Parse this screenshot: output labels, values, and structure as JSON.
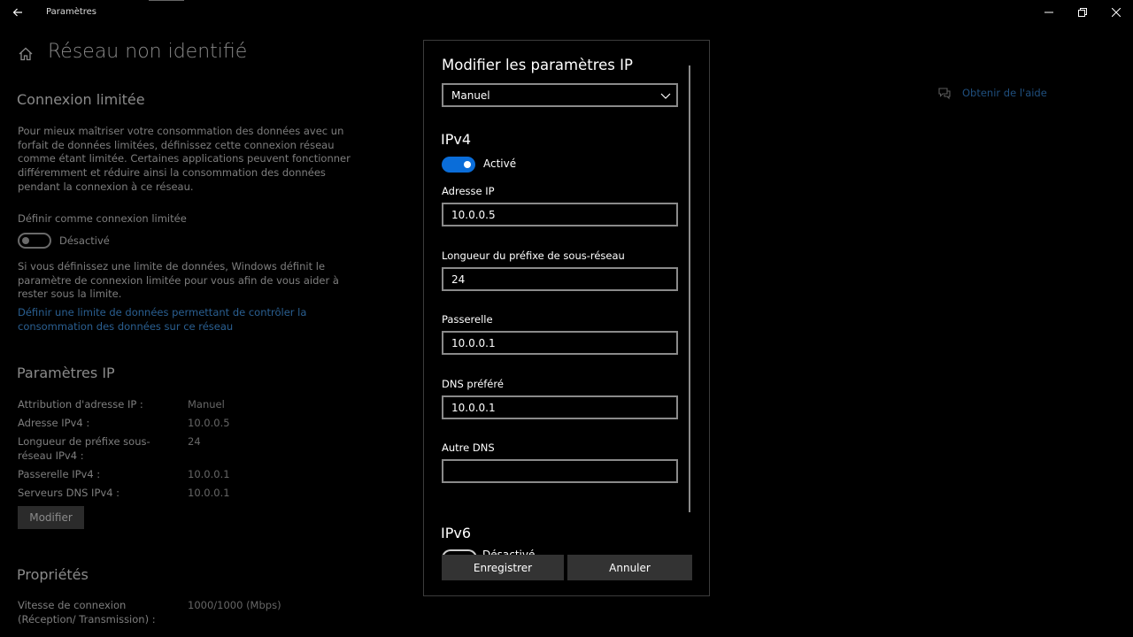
{
  "window": {
    "title": "Paramètres"
  },
  "page": {
    "title": "Réseau non identifié",
    "metered": {
      "heading": "Connexion limitée",
      "description": "Pour mieux maîtriser votre consommation des données avec un forfait de données limitées, définissez cette connexion réseau comme étant limitée. Certaines applications peuvent fonctionner différemment et réduire ainsi la consommation des données pendant la connexion à ce réseau.",
      "toggle_label": "Définir comme connexion limitée",
      "toggle_state": "Désactivé",
      "limit_note": "Si vous définissez une limite de données, Windows définit le paramètre de connexion limitée pour vous afin de vous aider à rester sous la limite.",
      "limit_link": "Définir une limite de données permettant de contrôler la consommation des données sur ce réseau"
    },
    "ip_settings": {
      "heading": "Paramètres IP",
      "rows": [
        {
          "key": "Attribution d'adresse IP :",
          "value": "Manuel"
        },
        {
          "key": "Adresse IPv4 :",
          "value": "10.0.0.5"
        },
        {
          "key": "Longueur de préfixe sous-réseau IPv4 :",
          "value": "24"
        },
        {
          "key": "Passerelle IPv4 :",
          "value": "10.0.0.1"
        },
        {
          "key": "Serveurs DNS IPv4 :",
          "value": "10.0.0.1"
        }
      ],
      "edit_button": "Modifier"
    },
    "properties": {
      "heading": "Propriétés",
      "speed_label": "Vitesse de connexion (Réception/ Transmission) :",
      "speed_value": "1000/1000 (Mbps)"
    },
    "help_link": "Obtenir de l'aide"
  },
  "dialog": {
    "title": "Modifier les paramètres IP",
    "mode": "Manuel",
    "ipv4": {
      "heading": "IPv4",
      "toggle_state": "Activé",
      "ip_label": "Adresse IP",
      "ip_value": "10.0.0.5",
      "prefix_label": "Longueur du préfixe de sous-réseau",
      "prefix_value": "24",
      "gateway_label": "Passerelle",
      "gateway_value": "10.0.0.1",
      "dns_label": "DNS préféré",
      "dns_value": "10.0.0.1",
      "alt_dns_label": "Autre DNS",
      "alt_dns_value": ""
    },
    "ipv6": {
      "heading": "IPv6",
      "toggle_state": "Désactivé"
    },
    "save_button": "Enregistrer",
    "cancel_button": "Annuler"
  },
  "colors": {
    "accent": "#0a6dd9",
    "link_dim": "#2a5f91",
    "background": "#000000"
  },
  "icons": [
    "back-arrow-icon",
    "minimize-icon",
    "maximize-icon",
    "close-icon",
    "home-icon",
    "help-chat-icon",
    "chevron-down-icon"
  ]
}
